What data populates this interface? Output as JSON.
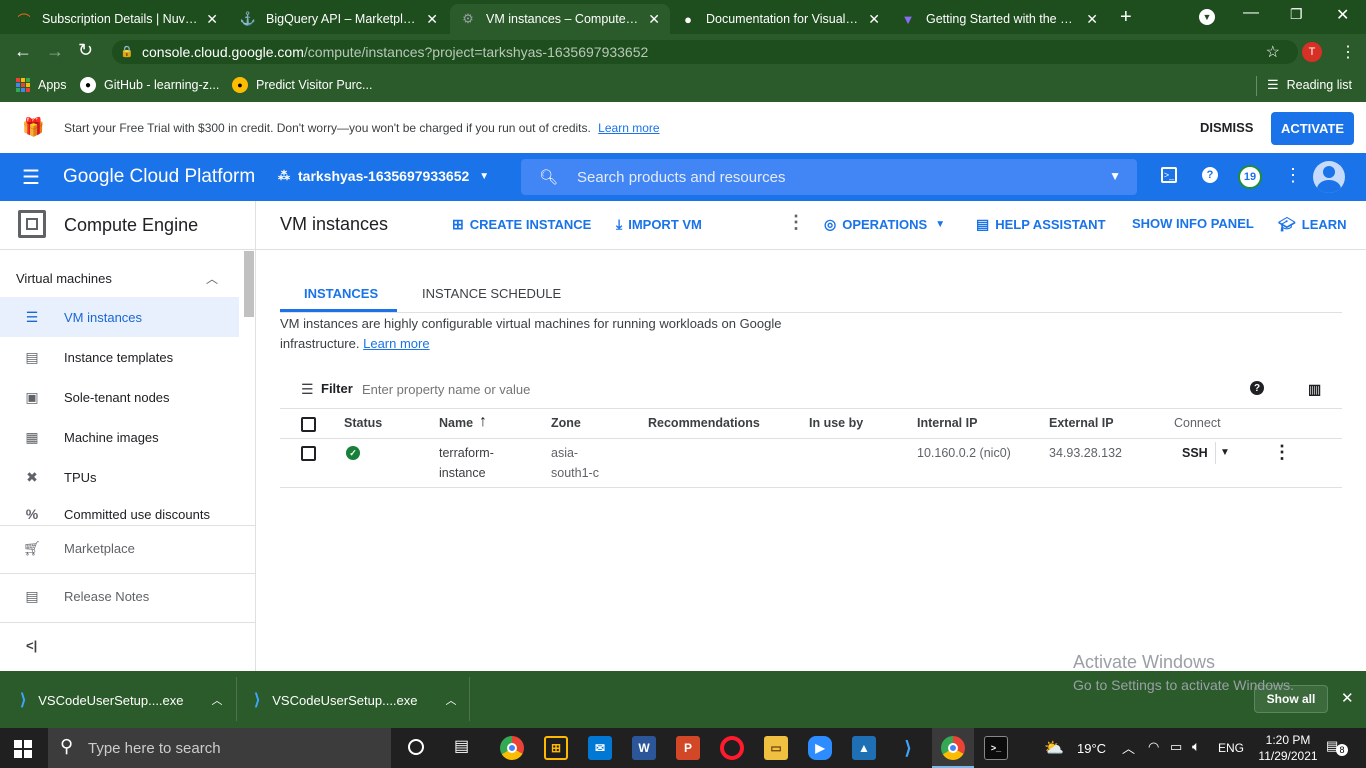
{
  "browser": {
    "tabs": [
      {
        "title": "Subscription Details | Nuvepro",
        "fav": "⌒",
        "color": "#f26b1d"
      },
      {
        "title": "BigQuery API – Marketplace",
        "fav": "⚓",
        "color": "#7aa6f5"
      },
      {
        "title": "VM instances – Compute Engine",
        "fav": "⚙",
        "color": "#9aa0a6"
      },
      {
        "title": "Documentation for Visual Studio",
        "fav": "●",
        "color": "#ffffff"
      },
      {
        "title": "Getting Started with the Google",
        "fav": "▼",
        "color": "#8a6cf5"
      }
    ],
    "url_host": "console.cloud.google.com",
    "url_path": "/compute/instances?project=tarkshyas-1635697933652",
    "profile_initial": "T",
    "bookmarks": [
      {
        "label": "Apps"
      },
      {
        "label": "GitHub - learning-z..."
      },
      {
        "label": "Predict Visitor Purc..."
      }
    ],
    "reading_list": "Reading list"
  },
  "trial": {
    "text": "Start your Free Trial with $300 in credit. Don't worry—you won't be charged if you run out of credits.",
    "link": "Learn more",
    "dismiss": "DISMISS",
    "activate": "ACTIVATE"
  },
  "header": {
    "brand": "Google Cloud Platform",
    "project": "tarkshyas-1635697933652",
    "search_placeholder": "Search products and resources",
    "notifications": "19"
  },
  "sidebar": {
    "product": "Compute Engine",
    "section": "Virtual machines",
    "items": [
      {
        "label": "VM instances",
        "icon": "☰"
      },
      {
        "label": "Instance templates",
        "icon": "▤"
      },
      {
        "label": "Sole-tenant nodes",
        "icon": "▣"
      },
      {
        "label": "Machine images",
        "icon": "▦"
      },
      {
        "label": "TPUs",
        "icon": "✖"
      },
      {
        "label": "Committed use discounts",
        "icon": "%"
      }
    ],
    "marketplace": "Marketplace",
    "release_notes": "Release Notes",
    "collapse": "<|"
  },
  "main": {
    "title": "VM instances",
    "actions": {
      "create": "CREATE INSTANCE",
      "import": "IMPORT VM",
      "operations": "OPERATIONS",
      "help": "HELP ASSISTANT",
      "info": "SHOW INFO PANEL",
      "learn": "LEARN"
    },
    "tabs": [
      "INSTANCES",
      "INSTANCE SCHEDULE"
    ],
    "desc_line1": "VM instances are highly configurable virtual machines for running workloads on Google",
    "desc_line2": "infrastructure.",
    "desc_link": "Learn more",
    "filter_label": "Filter",
    "filter_placeholder": "Enter property name or value",
    "columns": [
      "Status",
      "Name",
      "Zone",
      "Recommendations",
      "In use by",
      "Internal IP",
      "External IP",
      "Connect"
    ],
    "row": {
      "name_line1": "terraform-",
      "name_line2": "instance",
      "zone_line1": "asia-",
      "zone_line2": "south1-c",
      "internal_ip": "10.160.0.2 (nic0)",
      "external_ip": "34.93.28.132",
      "connect": "SSH"
    }
  },
  "watermark": {
    "line1": "Activate Windows",
    "line2": "Go to Settings to activate Windows."
  },
  "downloads": {
    "items": [
      "VSCodeUserSetup....exe",
      "VSCodeUserSetup....exe"
    ],
    "show_all": "Show all"
  },
  "taskbar": {
    "search_placeholder": "Type here to search",
    "temperature": "19°C",
    "lang": "ENG",
    "time": "1:20 PM",
    "date": "11/29/2021",
    "notif_count": "8"
  },
  "colors": {
    "accent": "#1a73e8",
    "chrome": "#2b5a2b",
    "status_ok": "#188038"
  }
}
